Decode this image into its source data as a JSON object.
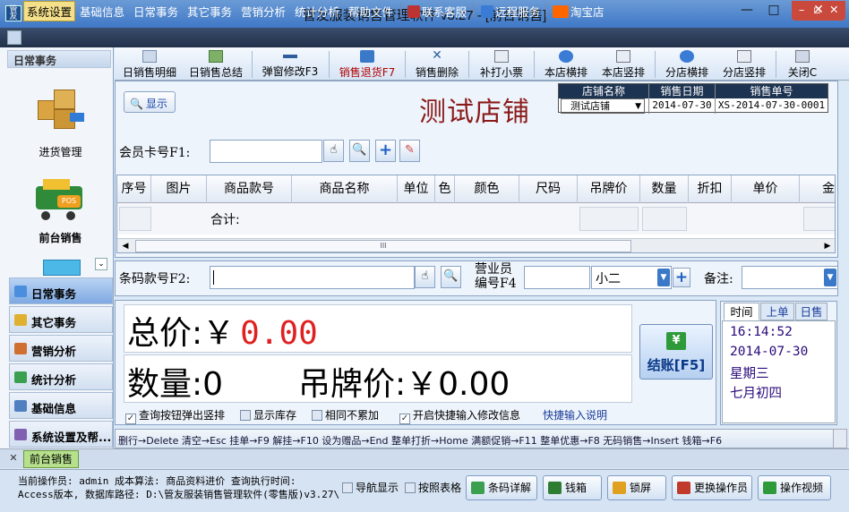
{
  "window": {
    "title": "管友服装销售管理软件 v3.27 - [前台销售]",
    "min": "—",
    "max": "□",
    "close": "✕",
    "app_icon": "管友"
  },
  "menubar": {
    "items": [
      "系统设置",
      "基础信息",
      "日常事务",
      "其它事务",
      "营销分析",
      "统计分析",
      "帮助文件"
    ],
    "extra": [
      "联系客服",
      "远程服务",
      "淘宝店"
    ],
    "right_controls": [
      "–",
      "▫",
      "✕"
    ]
  },
  "toolbar": {
    "items": [
      "日销售明细",
      "日销售总结",
      "弹窗修改F3",
      "销售退货F7",
      "销售删除",
      "补打小票",
      "本店横排",
      "本店竖排",
      "分店横排",
      "分店竖排",
      "关闭C"
    ]
  },
  "leftnav": {
    "header": "日常事务",
    "shortcuts": [
      "进货管理",
      "前台销售"
    ],
    "groups": [
      "日常事务",
      "其它事务",
      "营销分析",
      "统计分析",
      "基础信息",
      "系统设置及帮..."
    ]
  },
  "main": {
    "show_button": "显示",
    "store_title": "测试店铺",
    "info_headers": [
      "店铺名称",
      "销售日期",
      "销售单号"
    ],
    "info_values": {
      "store": "测试店铺",
      "date": "2014-07-30",
      "order_no": "XS-2014-07-30-0001"
    },
    "member_label": "会员卡号F1:",
    "member_value": "",
    "grid_headers": [
      "序号",
      "图片",
      "商品款号",
      "商品名称",
      "单位",
      "色",
      "颜色",
      "尺码",
      "吊牌价",
      "数量",
      "折扣",
      "单价",
      "金"
    ],
    "grid_sum_label": "合计:",
    "scroll_mark": "III"
  },
  "barrow": {
    "barcode_label": "条码款号F2:",
    "barcode_value": "",
    "clerk_label_1": "营业员",
    "clerk_label_2": "编号F4",
    "clerk_code": "",
    "clerk_name": "小二",
    "remark_label": "备注:",
    "remark_value": ""
  },
  "totals": {
    "total_label": "总价:",
    "currency": "￥",
    "total_value": "0.00",
    "qty_label": "数量:",
    "qty_value": "0",
    "tag_label": "吊牌价:",
    "tag_value": "￥0.00",
    "options": [
      {
        "label": "查询按钮弹出竖排",
        "checked": true
      },
      {
        "label": "显示库存",
        "checked": false
      },
      {
        "label": "相同不累加",
        "checked": false
      },
      {
        "label": "开启快捷输入修改信息",
        "checked": true
      }
    ],
    "help_link": "快捷输入说明",
    "checkout": "结账[F5]"
  },
  "timepanel": {
    "tabs": [
      "时间",
      "上单",
      "日售"
    ],
    "time": "16:14:52",
    "date": "2014-07-30",
    "weekday": "星期三",
    "lunar": "七月初四"
  },
  "shortcut_bar": "删行→Delete 清空→Esc  挂单→F9 解挂→F10  设为赠品→End 整单打折→Home 满额促销→F11 整单优惠→F8  无码销售→Insert  钱箱→F6",
  "doc_tab": {
    "label": "前台销售",
    "close": "✕"
  },
  "status": {
    "line1": "当前操作员: admin  成本算法: 商品资料进价  查询执行时间:",
    "line2": "Access版本, 数据库路径: D:\\管友服装销售管理软件(零售版)v3.27\\",
    "nav_toggle_1": "导航显示",
    "nav_toggle_2": "按照表格",
    "buttons": [
      "条码详解",
      "钱箱",
      "锁屏",
      "更换操作员",
      "操作视频"
    ]
  },
  "colors": {
    "accent": "#3f78c6",
    "store_title": "#8b1b1b",
    "total_value": "#e02020",
    "menu_bg": "#2a3a58",
    "active_tab": "#b6e08c"
  }
}
